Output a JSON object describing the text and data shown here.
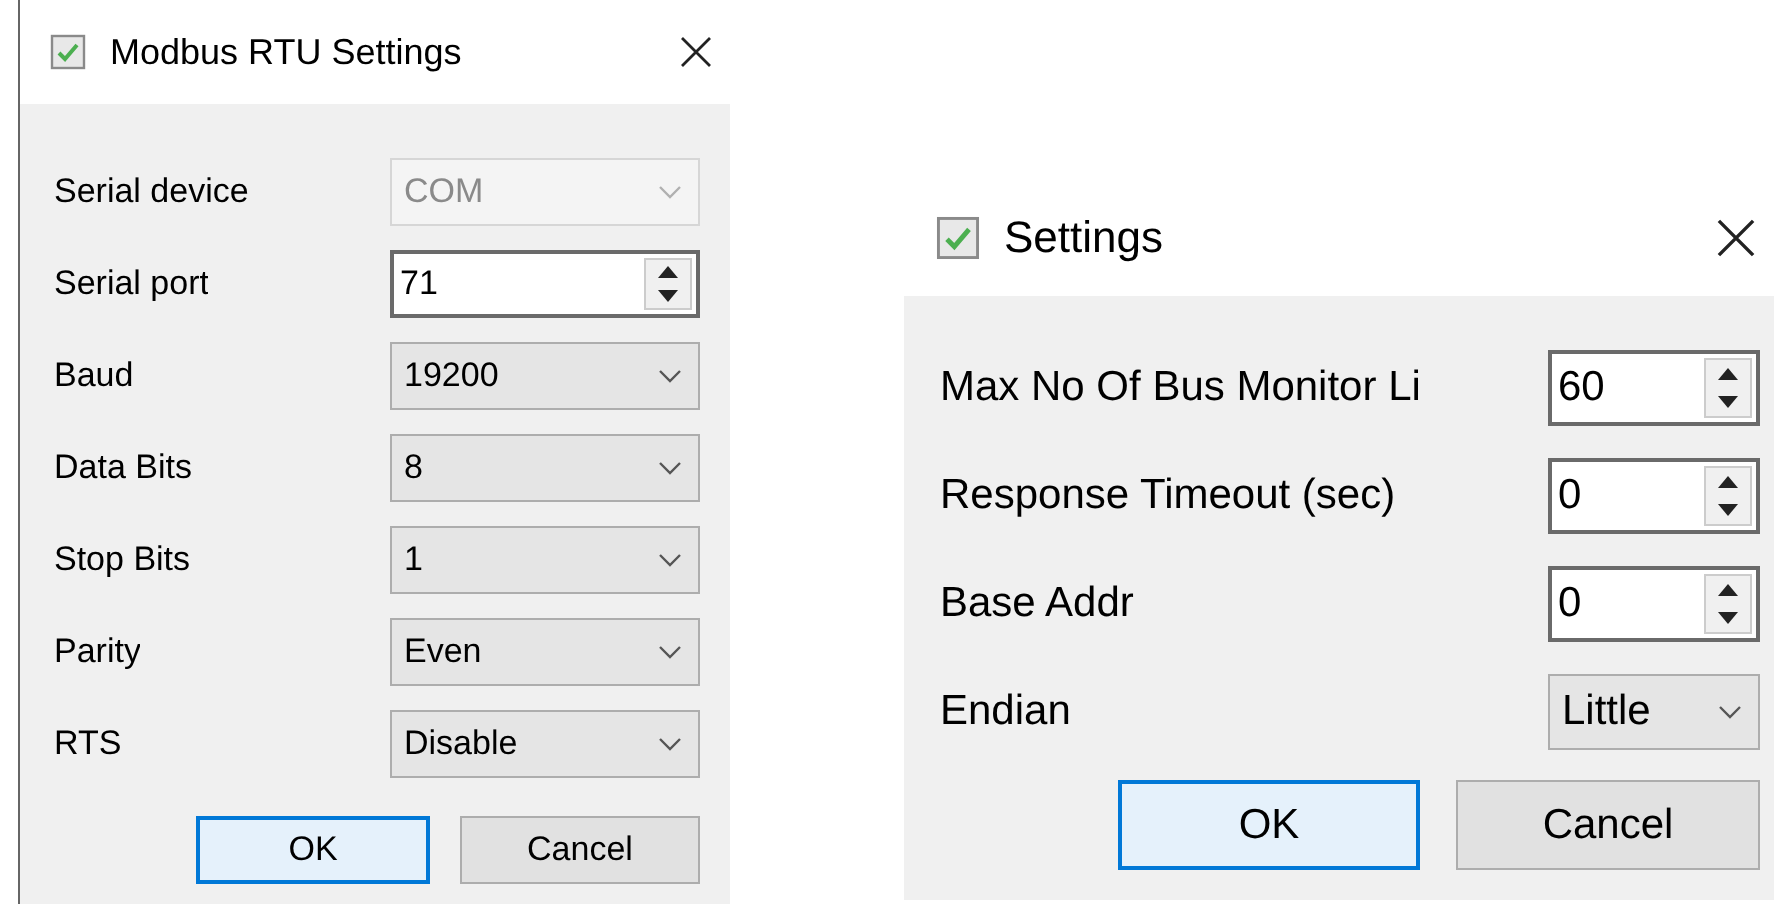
{
  "dialogs": [
    {
      "title": "Modbus RTU Settings",
      "rows": [
        {
          "label": "Serial device",
          "kind": "combo",
          "value": "COM",
          "disabled": true
        },
        {
          "label": "Serial port",
          "kind": "spin",
          "value": "71",
          "disabled": false
        },
        {
          "label": "Baud",
          "kind": "combo",
          "value": "19200",
          "disabled": false
        },
        {
          "label": "Data Bits",
          "kind": "combo",
          "value": "8",
          "disabled": false
        },
        {
          "label": "Stop Bits",
          "kind": "combo",
          "value": "1",
          "disabled": false
        },
        {
          "label": "Parity",
          "kind": "combo",
          "value": "Even",
          "disabled": false
        },
        {
          "label": "RTS",
          "kind": "combo",
          "value": "Disable",
          "disabled": false
        }
      ],
      "buttons": [
        {
          "label": "OK",
          "default": true
        },
        {
          "label": "Cancel",
          "default": false
        }
      ]
    },
    {
      "title": "Settings",
      "rows": [
        {
          "label": "Max No Of Bus Monitor Li",
          "kind": "spin",
          "value": "60",
          "disabled": false
        },
        {
          "label": "Response Timeout (sec)",
          "kind": "spin",
          "value": "0",
          "disabled": false
        },
        {
          "label": "Base Addr",
          "kind": "spin",
          "value": "0",
          "disabled": false
        },
        {
          "label": "Endian",
          "kind": "combo",
          "value": "Little",
          "disabled": false
        }
      ],
      "buttons": [
        {
          "label": "OK",
          "default": true
        },
        {
          "label": "Cancel",
          "default": false
        }
      ]
    }
  ]
}
